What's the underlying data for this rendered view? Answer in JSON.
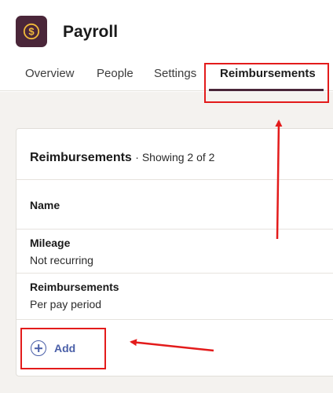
{
  "app": {
    "title": "Payroll",
    "icon": "dollar-coin-icon",
    "icon_bg": "#4a2639",
    "icon_fg": "#f0b93a"
  },
  "tabs": [
    {
      "label": "Overview",
      "active": false
    },
    {
      "label": "People",
      "active": false
    },
    {
      "label": "Settings",
      "active": false
    },
    {
      "label": "Reimbursements",
      "active": true
    }
  ],
  "card": {
    "title": "Reimbursements",
    "subtitle": "· Showing 2 of 2",
    "column_header": "Name",
    "rows": [
      {
        "name": "Mileage",
        "description": "Not recurring"
      },
      {
        "name": "Reimbursements",
        "description": "Per pay period"
      }
    ],
    "add_label": "Add"
  },
  "colors": {
    "accent": "#4a2639",
    "link": "#4a5fa8",
    "annotation": "#e31b1b",
    "background": "#f4f2ef"
  }
}
